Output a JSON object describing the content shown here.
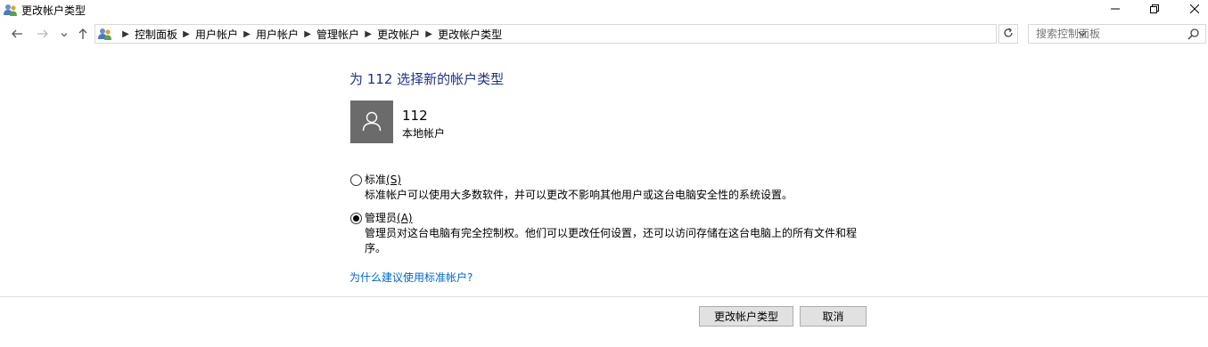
{
  "window": {
    "title": "更改帐户类型",
    "icon": "users-icon",
    "controls": [
      "minimize-icon",
      "restore-icon",
      "close-icon"
    ]
  },
  "nav": {
    "back_icon": "arrow-left-icon",
    "forward_icon": "arrow-right-icon",
    "recent_icon": "chevron-down-icon",
    "up_icon": "arrow-up-icon"
  },
  "address": {
    "breadcrumbs": [
      "控制面板",
      "用户帐户",
      "用户帐户",
      "管理帐户",
      "更改帐户",
      "更改帐户类型"
    ]
  },
  "search": {
    "placeholder": "搜索控制面板"
  },
  "main": {
    "heading": "为 112 选择新的帐户类型",
    "account": {
      "name": "112",
      "type": "本地帐户"
    },
    "options": [
      {
        "label": "标准",
        "accesskey": "(S)",
        "description": "标准帐户可以使用大多数软件，并可以更改不影响其他用户或这台电脑安全性的系统设置。",
        "selected": false
      },
      {
        "label": "管理员",
        "accesskey": "(A)",
        "description": "管理员对这台电脑有完全控制权。他们可以更改任何设置，还可以访问存储在这台电脑上的所有文件和程序。",
        "selected": true
      }
    ],
    "why_link": "为什么建议使用标准帐户?"
  },
  "footer": {
    "change_button": "更改帐户类型",
    "cancel_button": "取消"
  },
  "colors": {
    "heading": "#1e3287",
    "link": "#0066cc",
    "avatar_bg": "#6b6b6b"
  }
}
